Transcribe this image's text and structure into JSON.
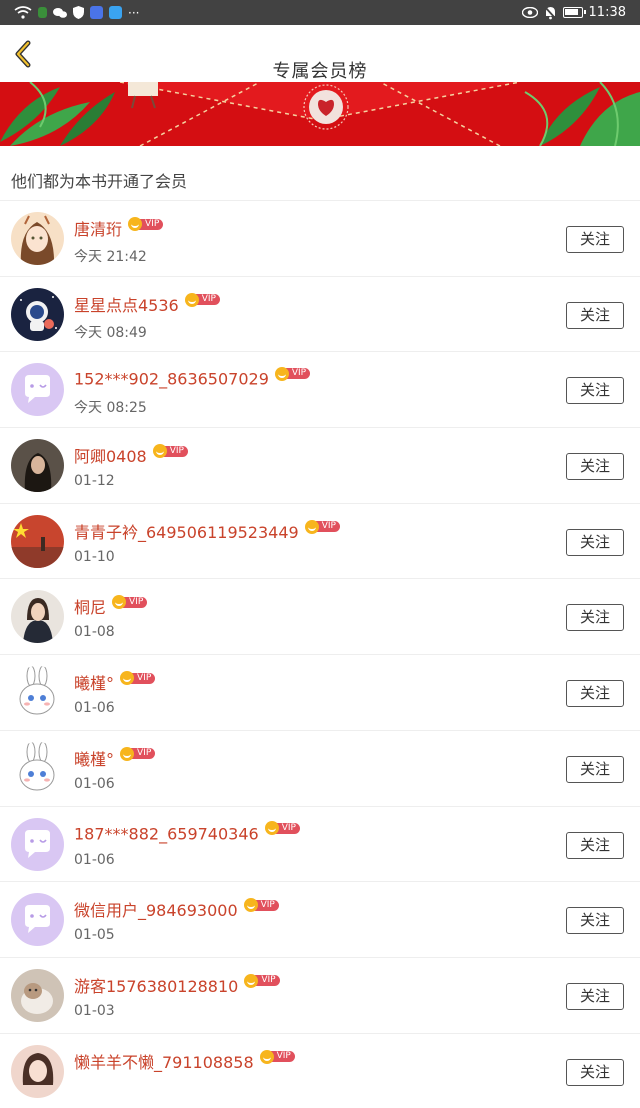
{
  "status_bar": {
    "time": "11:38",
    "dots": "···"
  },
  "header": {
    "title": "专属会员榜"
  },
  "subtitle": "他们都为本书开通了会员",
  "follow_label": "关注",
  "vip_label": "VIP",
  "members": [
    {
      "name": "唐清珩",
      "date": "今天 21:42",
      "avatar": "girl-illustration"
    },
    {
      "name": "星星点点4536",
      "date": "今天 08:49",
      "avatar": "astronaut"
    },
    {
      "name": "152***902_8636507029",
      "date": "今天 08:25",
      "avatar": "default-chat"
    },
    {
      "name": "阿卿0408",
      "date": "01-12",
      "avatar": "photo-dark"
    },
    {
      "name": "青青子衿_649506119523449",
      "date": "01-10",
      "avatar": "flag-red"
    },
    {
      "name": "桐尼",
      "date": "01-08",
      "avatar": "photo-woman"
    },
    {
      "name": "曦槿°",
      "date": "01-06",
      "avatar": "bunny"
    },
    {
      "name": "曦槿°",
      "date": "01-06",
      "avatar": "bunny"
    },
    {
      "name": "187***882_659740346",
      "date": "01-06",
      "avatar": "default-chat"
    },
    {
      "name": "微信用户_984693000",
      "date": "01-05",
      "avatar": "default-chat"
    },
    {
      "name": "游客1576380128810",
      "date": "01-03",
      "avatar": "photo-cat"
    },
    {
      "name": "懒羊羊不懒_791108858",
      "date": "",
      "avatar": "photo-girl"
    }
  ]
}
